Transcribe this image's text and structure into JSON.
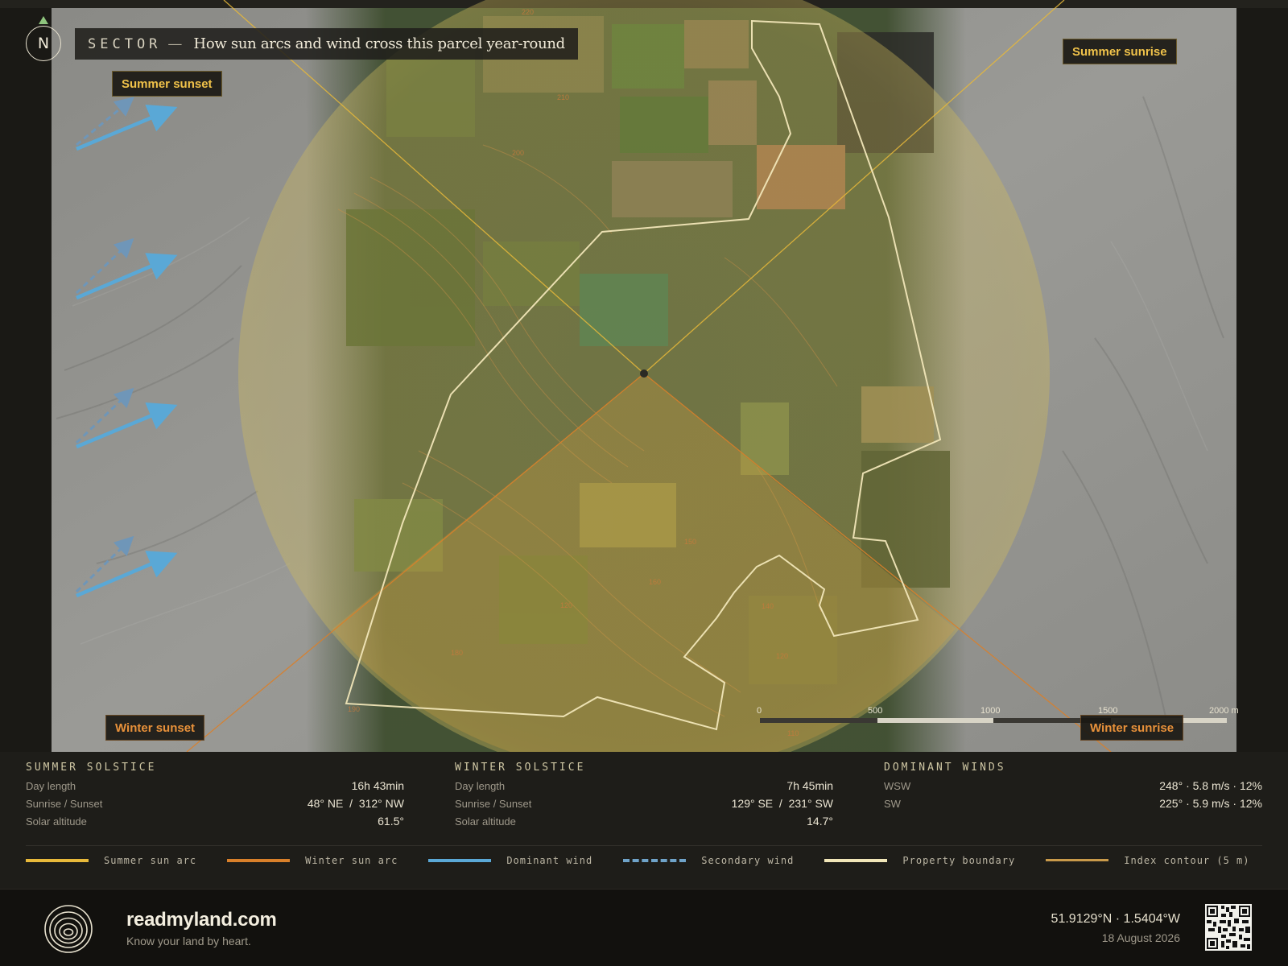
{
  "header": {
    "north": "N",
    "sector_label": "SECTOR",
    "dash": "—",
    "subtitle": "How sun arcs and wind cross this parcel year-round"
  },
  "map": {
    "sun_labels": {
      "summer_sunset": "Summer sunset",
      "summer_sunrise": "Summer sunrise",
      "winter_sunset": "Winter sunset",
      "winter_sunrise": "Winter sunrise"
    },
    "scale": {
      "ticks": [
        "0",
        "500",
        "1000",
        "1500",
        "2000 m"
      ]
    },
    "contour_labels": [
      "220",
      "210",
      "200",
      "190",
      "180",
      "150",
      "160",
      "120",
      "140",
      "120",
      "110"
    ],
    "colors": {
      "summer_arc": "#e8b93a",
      "winter_arc": "#d9802a",
      "dominant_wind": "#5aa8d6",
      "secondary_wind": "#6fa3c9",
      "boundary": "#f1e6b8",
      "contour": "#c97a3c"
    }
  },
  "summer": {
    "heading": "SUMMER SOLSTICE",
    "rows": [
      {
        "k": "Day length",
        "v": "16h 43min"
      },
      {
        "k": "Sunrise / Sunset",
        "v": "48° NE  /  312° NW"
      },
      {
        "k": "Solar altitude",
        "v": "61.5°"
      }
    ]
  },
  "winter": {
    "heading": "WINTER SOLSTICE",
    "rows": [
      {
        "k": "Day length",
        "v": "7h 45min"
      },
      {
        "k": "Sunrise / Sunset",
        "v": "129° SE  /  231° SW"
      },
      {
        "k": "Solar altitude",
        "v": "14.7°"
      }
    ]
  },
  "winds": {
    "heading": "DOMINANT WINDS",
    "rows": [
      {
        "k": "WSW",
        "v": "248° · 5.8 m/s · 12%"
      },
      {
        "k": "SW",
        "v": "225° · 5.9 m/s · 12%"
      }
    ]
  },
  "legend": [
    {
      "label": "Summer sun arc",
      "color": "#e8b93a"
    },
    {
      "label": "Winter sun arc",
      "color": "#d9802a"
    },
    {
      "label": "Dominant wind",
      "color": "#5aa8d6"
    },
    {
      "label": "Secondary wind",
      "color": "#6fa3c9"
    },
    {
      "label": "Property boundary",
      "color": "#f1e6b8"
    },
    {
      "label": "Index contour (5 m)",
      "color": "#c99a4a"
    }
  ],
  "footer": {
    "brand": "readmyland.com",
    "tagline": "Know your land by heart.",
    "coords": "51.9129°N · 1.5404°W",
    "date": "18 August 2026"
  }
}
